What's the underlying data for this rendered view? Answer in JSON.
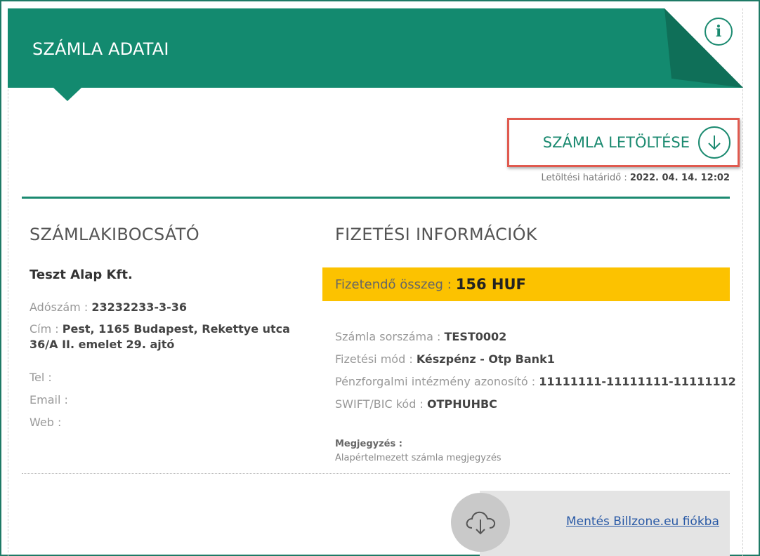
{
  "header": {
    "title": "SZÁMLA ADATAI",
    "brand_color": "#138a6f",
    "info_icon": "info-icon"
  },
  "download": {
    "label": "SZÁMLA LETÖLTÉSE",
    "icon": "download-arrow-icon",
    "deadline_label": "Letöltési határidő :",
    "deadline_value": "2022. 04. 14. 12:02"
  },
  "issuer": {
    "section_title": "SZÁMLAKIBOCSÁTÓ",
    "name": "Teszt Alap Kft.",
    "tax_label": "Adószám :",
    "tax_value": "23232233-3-36",
    "address_label": "Cím :",
    "address_line1": "Pest, 1165 Budapest, Rekettye utca",
    "address_line2": "36/A II. emelet 29. ajtó",
    "tel_label": "Tel :",
    "email_label": "Email :",
    "web_label": "Web :"
  },
  "payment": {
    "section_title": "FIZETÉSI INFORMÁCIÓK",
    "amount_label": "Fizetendő összeg :",
    "amount_value": "156 HUF",
    "amount_bg": "#fcc200",
    "invoice_no_label": "Számla sorszáma :",
    "invoice_no_value": "TEST0002",
    "method_label": "Fizetési mód :",
    "method_value": "Készpénz - Otp Bank1",
    "account_label": "Pénzforgalmi intézmény azonosító :",
    "account_value": "11111111-11111111-11111112",
    "swift_label": "SWIFT/BIC kód :",
    "swift_value": "OTPHUHBC",
    "note_label": "Megjegyzés :",
    "note_text": "Alapértelmezett számla megjegyzés"
  },
  "save": {
    "icon": "cloud-download-icon",
    "link_text": "Mentés Billzone.eu fiókba"
  }
}
